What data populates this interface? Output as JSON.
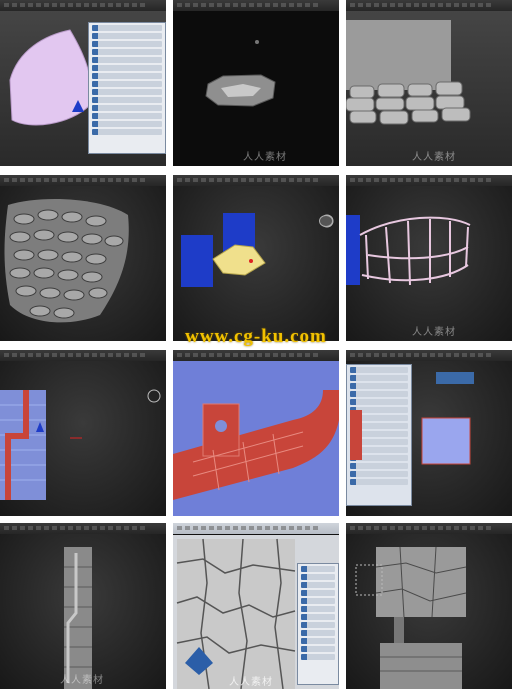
{
  "grid": {
    "tiles": [
      {
        "name": "tile-pink-mesh-editor"
      },
      {
        "name": "tile-single-stone"
      },
      {
        "name": "tile-stone-wall"
      },
      {
        "name": "tile-stone-cluster"
      },
      {
        "name": "tile-blue-pillars"
      },
      {
        "name": "tile-wire-cage"
      },
      {
        "name": "tile-pillar-pipe"
      },
      {
        "name": "tile-red-pipe-closeup"
      },
      {
        "name": "tile-uv-editor"
      },
      {
        "name": "tile-tall-column"
      },
      {
        "name": "tile-cracked-texture"
      },
      {
        "name": "tile-column-composite"
      }
    ]
  },
  "watermark": {
    "text": "人人素材"
  },
  "site_url": "www.cg-ku.com",
  "colors": {
    "viewport_dark": "#1b1b1b",
    "stone_grey": "#9a9a9a",
    "pillar_blue": "#1e3cc8",
    "pipe_red": "#c8453a",
    "mesh_pink": "#e2c7f0",
    "url_yellow": "#f2c200"
  }
}
